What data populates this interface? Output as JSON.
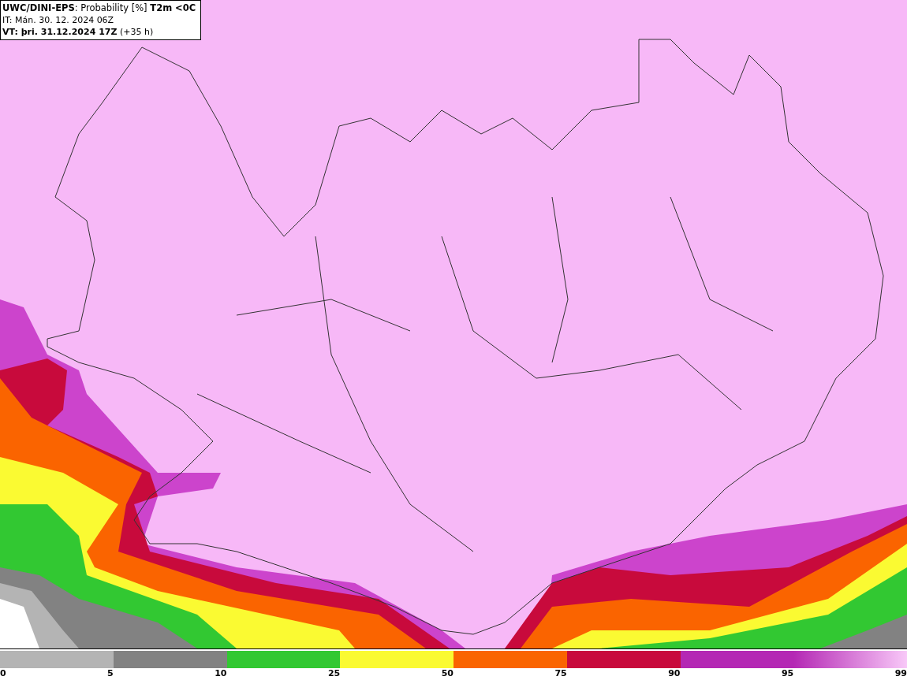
{
  "header": {
    "lines": [
      "**UWC/DINI-EPS**: Probability [%] **T2m <0C**",
      "IT: Mán. 30. 12. 2024 06Z",
      "**VT: þri. 31.12.2024 17Z** (+35 h)"
    ]
  },
  "legend": {
    "segments": [
      {
        "color": "#b4b4b4"
      },
      {
        "color": "#828282"
      },
      {
        "color": "#32c832"
      },
      {
        "color": "#fafa32"
      },
      {
        "color": "#fa6400"
      },
      {
        "color": "#c80a3c"
      },
      {
        "color": "#b428b4"
      },
      {
        "kind": "gradient"
      }
    ],
    "ticks": [
      "0",
      "5",
      "10",
      "25",
      "50",
      "75",
      "90",
      "95",
      "99"
    ]
  }
}
